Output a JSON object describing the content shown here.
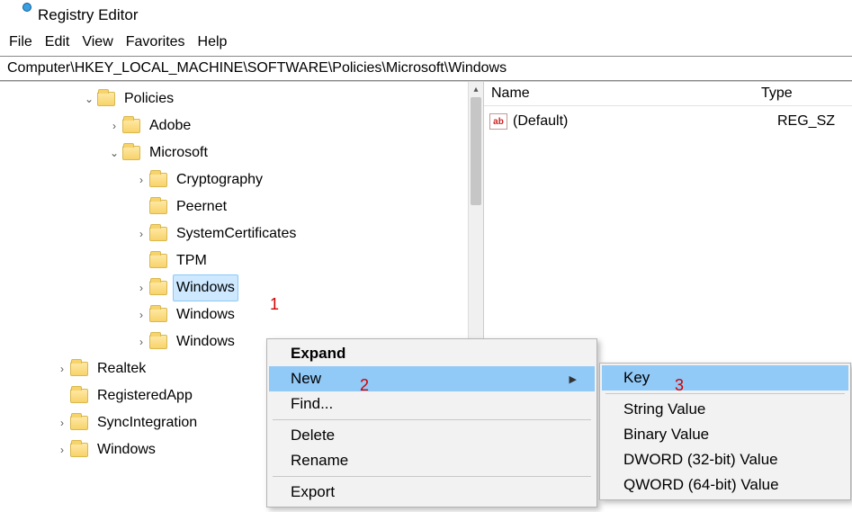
{
  "window": {
    "title": "Registry Editor"
  },
  "menu": {
    "file": "File",
    "edit": "Edit",
    "view": "View",
    "favorites": "Favorites",
    "help": "Help"
  },
  "address": "Computer\\HKEY_LOCAL_MACHINE\\SOFTWARE\\Policies\\Microsoft\\Windows",
  "tree": {
    "policies": {
      "label": "Policies",
      "expander": "⌄"
    },
    "adobe": {
      "label": "Adobe",
      "expander": "›"
    },
    "microsoft": {
      "label": "Microsoft",
      "expander": "⌄"
    },
    "crypt": {
      "label": "Cryptography",
      "expander": "›"
    },
    "peernet": {
      "label": "Peernet",
      "expander": ""
    },
    "syscert": {
      "label": "SystemCertificates",
      "expander": "›"
    },
    "tpm": {
      "label": "TPM",
      "expander": ""
    },
    "windows": {
      "label": "Windows",
      "expander": "›"
    },
    "windows2": {
      "label": "Windows",
      "expander": "›"
    },
    "windows3": {
      "label": "Windows",
      "expander": "›"
    },
    "realtek": {
      "label": "Realtek",
      "expander": "›"
    },
    "regapp": {
      "label": "RegisteredApp",
      "expander": ""
    },
    "syncint": {
      "label": "SyncIntegration",
      "expander": "›"
    },
    "bwindows": {
      "label": "Windows",
      "expander": "›"
    }
  },
  "list": {
    "header": {
      "name": "Name",
      "type": "Type"
    },
    "rows": [
      {
        "icon": "ab",
        "name": "(Default)",
        "type": "REG_SZ"
      }
    ]
  },
  "context1": {
    "expand": "Expand",
    "new": "New",
    "find": "Find...",
    "delete": "Delete",
    "rename": "Rename",
    "export": "Export"
  },
  "context2": {
    "key": "Key",
    "string": "String Value",
    "binary": "Binary Value",
    "dword": "DWORD (32-bit) Value",
    "qword": "QWORD (64-bit) Value"
  },
  "annotations": {
    "a1": "1",
    "a2": "2",
    "a3": "3"
  }
}
